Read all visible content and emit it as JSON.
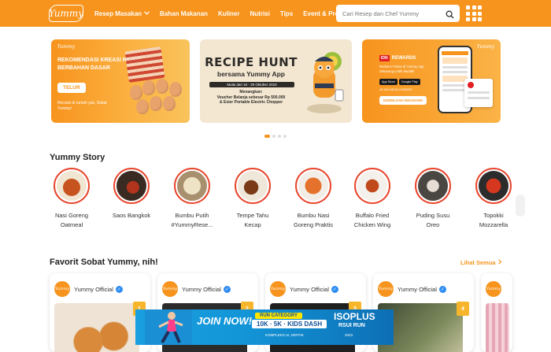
{
  "header": {
    "logo": "Yummy",
    "nav": [
      {
        "label": "Resep Masakan",
        "has_dropdown": true
      },
      {
        "label": "Bahan Makanan"
      },
      {
        "label": "Kuliner"
      },
      {
        "label": "Nutrisi"
      },
      {
        "label": "Tips"
      },
      {
        "label": "Event & Promosi"
      }
    ],
    "search_placeholder": "Cari Resep dan Chef Yummy",
    "icons": [
      "search-icon",
      "grid-menu-icon",
      "chevron-down-icon"
    ]
  },
  "banners": [
    {
      "logo": "Yummy",
      "title": "REKOMENDASI KREASI RESEP BERBAHAN DASAR",
      "tag": "TELUR",
      "subtitle": "Recook di rumah yuk, Sobat Yummy!"
    },
    {
      "title": "RECIPE HUNT",
      "subtitle": "bersama Yummy App",
      "dates": "Mulai dari 16 - 29 Oktober 2023",
      "prize_heading": "Menangkan:",
      "prize_1": "Voucher Belanja sebesar Rp 500.000",
      "prize_2": "& Esier Portable Electric Chopper"
    },
    {
      "logo": "Yummy",
      "badge": "IDN",
      "title": "REWARDS",
      "subtitle": "Redeem Points di Yummy App Sekarang Lebih Mudah!",
      "store_1": "App Store",
      "store_2": "Google Play",
      "media": "AN IDN MEDIA COMPANY",
      "cta": "DOWNLOAD SEKARANG"
    }
  ],
  "carousel": {
    "total_slides": 4,
    "active_index": 0
  },
  "story": {
    "title": "Yummy Story",
    "items": [
      {
        "label_1": "Nasi Goreng",
        "label_2": "Oatmeal"
      },
      {
        "label_1": "Saos Bangkok",
        "label_2": ""
      },
      {
        "label_1": "Bumbu Putih",
        "label_2": "#YummyRese..."
      },
      {
        "label_1": "Tempe Tahu",
        "label_2": "Kecap"
      },
      {
        "label_1": "Bumbu Nasi",
        "label_2": "Goreng Praktis"
      },
      {
        "label_1": "Buffalo Fried",
        "label_2": "Chicken Wing"
      },
      {
        "label_1": "Puding Susu",
        "label_2": "Oreo"
      },
      {
        "label_1": "Topokki",
        "label_2": "Mozzarella"
      }
    ]
  },
  "favorites": {
    "title": "Favorit Sobat Yummy, nih!",
    "see_all": "Lihat Semua",
    "cards": [
      {
        "author": "Yummy Official",
        "rank": "1"
      },
      {
        "author": "Yummy Official",
        "rank": "2"
      },
      {
        "author": "Yummy Official",
        "rank": "3"
      },
      {
        "author": "Yummy Official",
        "rank": "4"
      },
      {
        "author": "Yummy Official",
        "rank": ""
      }
    ]
  },
  "ad": {
    "join": "JOIN NOW!",
    "category": "RUN CATEGORY",
    "distances": "10K · 5K · KIDS DASH",
    "location": "KOMPLEKS UI, DEPOK",
    "brand": "ISOPLUS",
    "event": "RSUI RUN",
    "year": "2023"
  },
  "colors": {
    "brand": "#f7941d",
    "story_ring": "#e8452c",
    "verified": "#2f8cf2",
    "rank_badge": "#f7b52c"
  }
}
